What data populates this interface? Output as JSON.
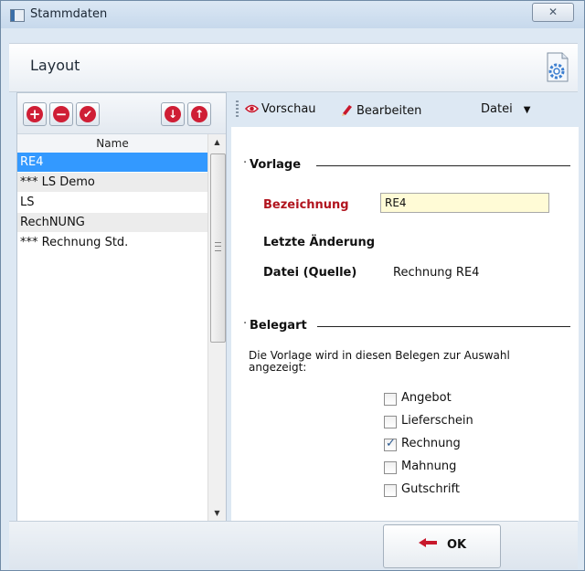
{
  "window": {
    "title": "Stammdaten",
    "close_label": "✕"
  },
  "header": {
    "title": "Layout"
  },
  "left": {
    "column_header": "Name",
    "items": [
      "RE4",
      "*** LS Demo",
      "LS",
      "RechNUNG",
      "*** Rechnung Std."
    ],
    "selected_index": 0
  },
  "toolbar": {
    "preview_label": "Vorschau",
    "edit_label": "Bearbeiten",
    "file_label": "Datei"
  },
  "vorlage": {
    "title": "Vorlage",
    "bezeichnung_label": "Bezeichnung",
    "bezeichnung_value": "RE4",
    "letzte_label": "Letzte Änderung",
    "datei_label": "Datei (Quelle)",
    "datei_value": "Rechnung RE4"
  },
  "belegart": {
    "title": "Belegart",
    "description": "Die Vorlage wird in diesen Belegen zur Auswahl angezeigt:",
    "options": [
      {
        "label": "Angebot",
        "checked": false
      },
      {
        "label": "Lieferschein",
        "checked": false
      },
      {
        "label": "Rechnung",
        "checked": true
      },
      {
        "label": "Mahnung",
        "checked": false
      },
      {
        "label": "Gutschrift",
        "checked": false
      }
    ]
  },
  "footer": {
    "ok_label": "OK"
  },
  "colors": {
    "accent_red": "#cf1e35",
    "selection": "#3399ff",
    "label_red": "#b1141e"
  }
}
